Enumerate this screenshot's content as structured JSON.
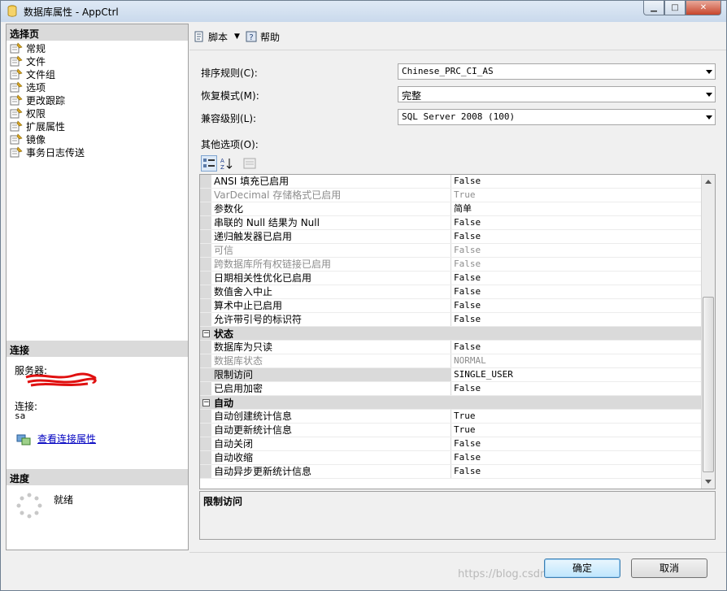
{
  "window": {
    "title": "数据库属性 - AppCtrl"
  },
  "left": {
    "select_page_header": "选择页",
    "pages": [
      {
        "label": "常规"
      },
      {
        "label": "文件"
      },
      {
        "label": "文件组"
      },
      {
        "label": "选项"
      },
      {
        "label": "更改跟踪"
      },
      {
        "label": "权限"
      },
      {
        "label": "扩展属性"
      },
      {
        "label": "镜像"
      },
      {
        "label": "事务日志传送"
      }
    ],
    "connection_header": "连接",
    "server_label": "服务器:",
    "connection_label": "连接:",
    "connection_value": "sa",
    "view_connection_link": "查看连接属性",
    "progress_header": "进度",
    "progress_status": "就绪"
  },
  "toolbar": {
    "script_label": "脚本",
    "help_label": "帮助"
  },
  "fields": {
    "collation_label": "排序规则(C):",
    "collation_value": "Chinese_PRC_CI_AS",
    "recovery_label": "恢复模式(M):",
    "recovery_value": "完整",
    "compat_label": "兼容级别(L):",
    "compat_value": "SQL Server 2008 (100)",
    "other_options_label": "其他选项(O):"
  },
  "grid": {
    "rows_top": [
      {
        "name": "ANSI 填充已启用",
        "value": "False"
      },
      {
        "name": "VarDecimal 存储格式已启用",
        "value": "True"
      },
      {
        "name": "参数化",
        "value": "简单"
      },
      {
        "name": "串联的 Null 结果为 Null",
        "value": "False"
      },
      {
        "name": "递归触发器已启用",
        "value": "False"
      },
      {
        "name": "可信",
        "value": "False"
      },
      {
        "name": "跨数据库所有权链接已启用",
        "value": "False"
      },
      {
        "name": "日期相关性优化已启用",
        "value": "False"
      },
      {
        "name": "数值舍入中止",
        "value": "False"
      },
      {
        "name": "算术中止已启用",
        "value": "False"
      },
      {
        "name": "允许带引号的标识符",
        "value": "False"
      }
    ],
    "cat_state": "状态",
    "toggle_symbol": "−",
    "rows_state": [
      {
        "name": "数据库为只读",
        "value": "False"
      },
      {
        "name": "数据库状态",
        "value": "NORMAL"
      },
      {
        "name": "限制访问",
        "value": "SINGLE_USER"
      },
      {
        "name": "已启用加密",
        "value": "False"
      }
    ],
    "cat_auto": "自动",
    "rows_auto": [
      {
        "name": "自动创建统计信息",
        "value": "True"
      },
      {
        "name": "自动更新统计信息",
        "value": "True"
      },
      {
        "name": "自动关闭",
        "value": "False"
      },
      {
        "name": "自动收缩",
        "value": "False"
      },
      {
        "name": "自动异步更新统计信息",
        "value": "False"
      }
    ]
  },
  "description": {
    "title": "限制访问"
  },
  "buttons": {
    "ok": "确定",
    "cancel": "取消"
  },
  "watermark": "https://blog.csdn.net/..."
}
